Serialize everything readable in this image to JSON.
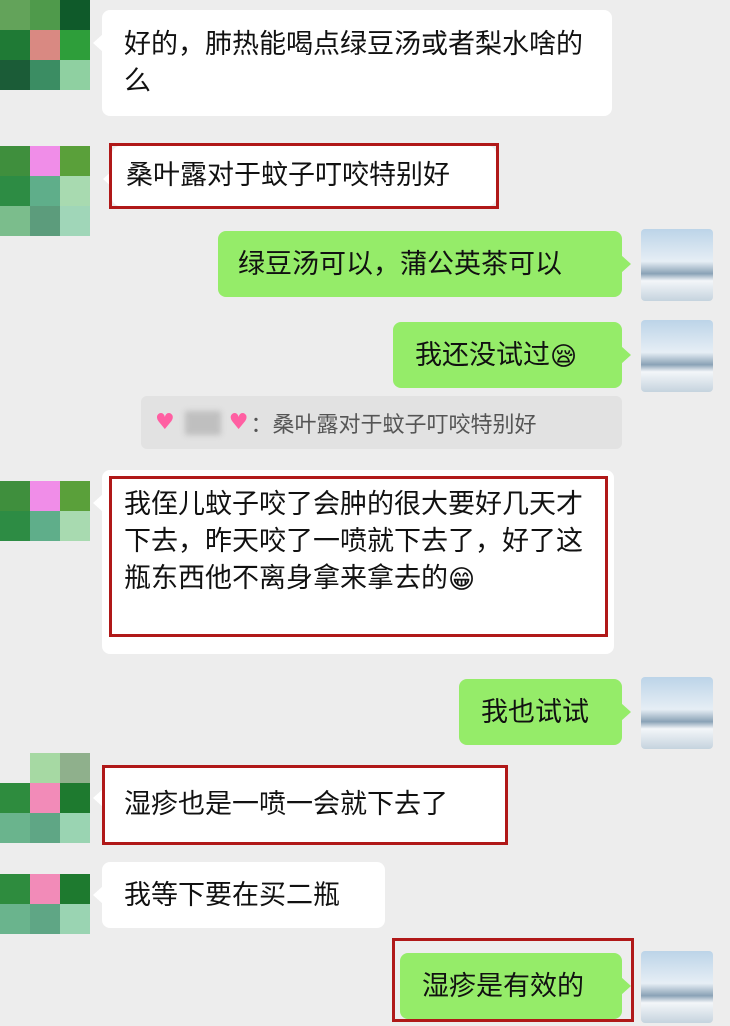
{
  "colors": {
    "background": "#ededed",
    "bubble_left": "#ffffff",
    "bubble_right": "#95ec69",
    "highlight_border": "#b01818"
  },
  "messages": [
    {
      "side": "left",
      "text": "好的，肺热能喝点绿豆汤或者梨水啥的么"
    },
    {
      "side": "left",
      "text": "桑叶露对于蚊子叮咬特别好"
    },
    {
      "side": "right",
      "text": "绿豆汤可以，蒲公英茶可以"
    },
    {
      "side": "right",
      "text": "我还没试过",
      "emoji": "😪"
    },
    {
      "quote": {
        "suffix": "：桑叶露对于蚊子叮咬特别好",
        "icon": "pink-heart-icon"
      }
    },
    {
      "side": "left",
      "text": "我侄儿蚊子咬了会肿的很大要好几天才下去，昨天咬了一喷就下去了，好了这瓶东西他不离身拿来拿去的",
      "emoji": "😁"
    },
    {
      "side": "right",
      "text": "我也试试"
    },
    {
      "side": "left",
      "text": "湿疹也是一喷一会就下去了"
    },
    {
      "side": "left",
      "text": "我等下要在买二瓶"
    },
    {
      "side": "right",
      "text": "湿疹是有效的"
    }
  ]
}
